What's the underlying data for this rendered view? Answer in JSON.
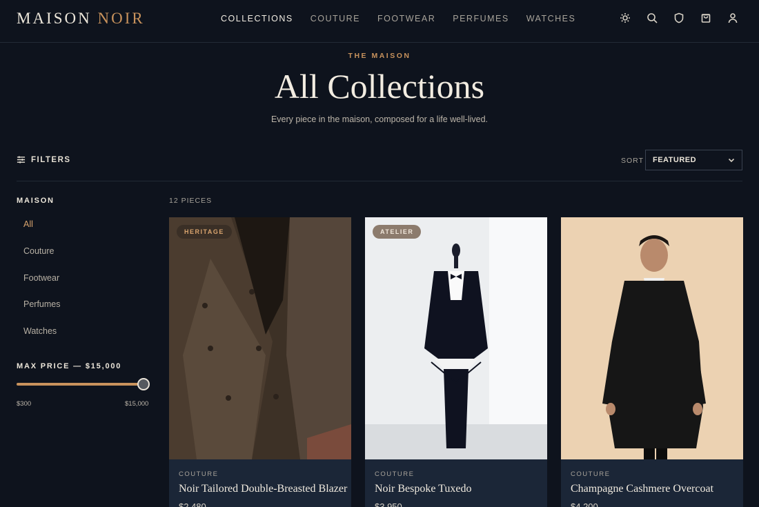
{
  "brand": {
    "name_primary": "MAISON",
    "name_accent": "NOIR",
    "accent_color": "#c8925c"
  },
  "nav": [
    {
      "label": "COLLECTIONS",
      "active": true
    },
    {
      "label": "COUTURE"
    },
    {
      "label": "FOOTWEAR"
    },
    {
      "label": "PERFUMES"
    },
    {
      "label": "WATCHES"
    }
  ],
  "header_icons": [
    "sun-icon",
    "search-icon",
    "shield-icon",
    "shopping-bag-icon",
    "user-icon"
  ],
  "hero": {
    "eyebrow": "THE MAISON",
    "title": "All Collections",
    "subtitle": "Every piece in the maison, composed for a life well-lived."
  },
  "toolbar": {
    "filters_label": "FILTERS",
    "sort_label": "SORT",
    "sort_value": "FEATURED"
  },
  "sidebar": {
    "title": "MAISON",
    "items": [
      {
        "label": "All",
        "active": true
      },
      {
        "label": "Couture"
      },
      {
        "label": "Footwear"
      },
      {
        "label": "Perfumes"
      },
      {
        "label": "Watches"
      }
    ],
    "price": {
      "title": "MAX PRICE — $15,000",
      "min_label": "$300",
      "max_label": "$15,000",
      "value_fraction": 1.0
    }
  },
  "products": {
    "count_label": "12 PIECES",
    "items": [
      {
        "badge": "HERITAGE",
        "category": "COUTURE",
        "name": "Noir Tailored Double-Breasted Blazer",
        "price": "$2,480"
      },
      {
        "badge": "ATELIER",
        "category": "COUTURE",
        "name": "Noir Bespoke Tuxedo",
        "price": "$3,950"
      },
      {
        "badge": "",
        "category": "COUTURE",
        "name": "Champagne Cashmere Overcoat",
        "price": "$4,200"
      }
    ]
  }
}
